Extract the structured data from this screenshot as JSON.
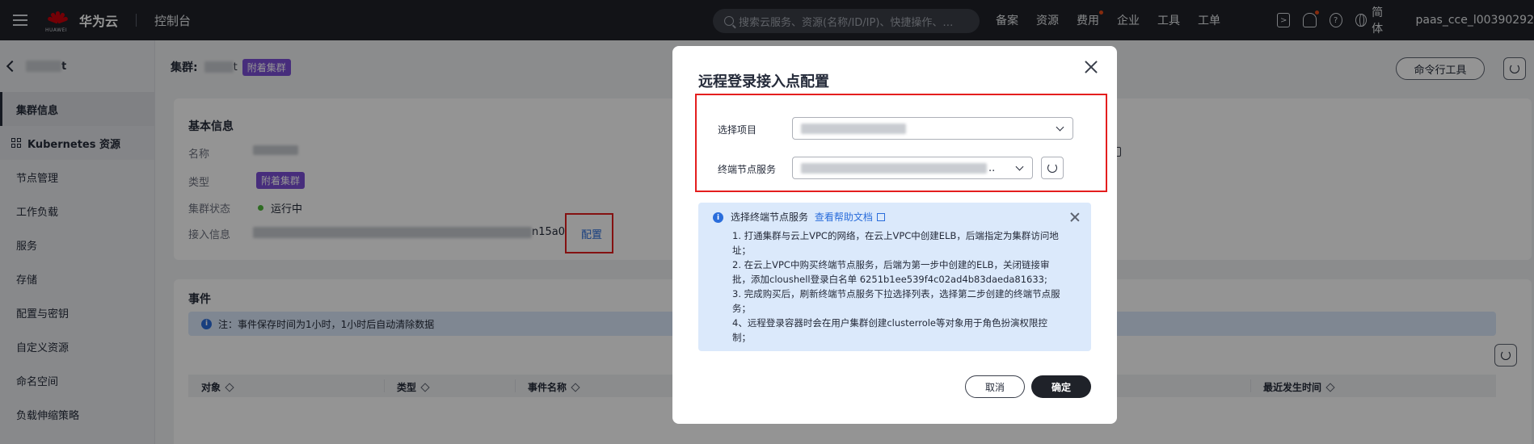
{
  "topbar": {
    "brand": "华为云",
    "logo_sub": "HUAWEI",
    "console": "控制台",
    "search_placeholder": "搜索云服务、资源(名称/ID/IP)、快捷操作、…",
    "links": [
      "备案",
      "资源",
      "费用",
      "企业",
      "工具",
      "工单"
    ],
    "lang": "简体",
    "user": "paas_cce_l00390292"
  },
  "sidebar": {
    "back_suffix": "t",
    "items": [
      "集群信息",
      "Kubernetes 资源",
      "节点管理",
      "工作负载",
      "服务",
      "存储",
      "配置与密钥",
      "自定义资源",
      "命名空间",
      "负载伸缩策略"
    ]
  },
  "main": {
    "cluster_label": "集群:",
    "cluster_suffix": "t",
    "cluster_tag": "附着集群",
    "cmd_button": "命令行工具",
    "basic": {
      "title": "基本信息",
      "name_label": "名称",
      "type_label": "类型",
      "type_value": "附着集群",
      "status_label": "集群状态",
      "status_value": "运行中",
      "access_label": "接入信息",
      "access_suffix": "n15a0",
      "config_link": "配置"
    },
    "events": {
      "title": "事件",
      "note": "注：事件保存时间为1小时，1小时后自动清除数据",
      "columns": [
        "对象",
        "类型",
        "事件名称",
        "最近发生时间"
      ]
    }
  },
  "modal": {
    "title": "远程登录接入点配置",
    "project_label": "选择项目",
    "endpoint_label": "终端节点服务",
    "endpoint_ellipsis": "..",
    "info_head": "选择终端节点服务",
    "help_link": "查看帮助文档",
    "info_lines": [
      "1. 打通集群与云上VPC的网络，在云上VPC中创建ELB，后端指定为集群访问地址；",
      "2. 在云上VPC中购买终端节点服务，后端为第一步中创建的ELB，关闭链接审批，添加cloushell登录白名单 6251b1ee539f4c02ad4b83daeda81633;",
      "3. 完成购买后，刷新终端节点服务下拉选择列表，选择第二步创建的终端节点服务；",
      "4、远程登录容器时会在用户集群创建clusterrole等对象用于角色扮演权限控制；"
    ],
    "cancel": "取消",
    "ok": "确定"
  },
  "colors": {
    "topbar": "#1f2229",
    "accent_tag": "#7b4fd6",
    "link": "#2a6ddb",
    "highlight": "#e41e1e",
    "info_bg": "#dbe9fb"
  }
}
